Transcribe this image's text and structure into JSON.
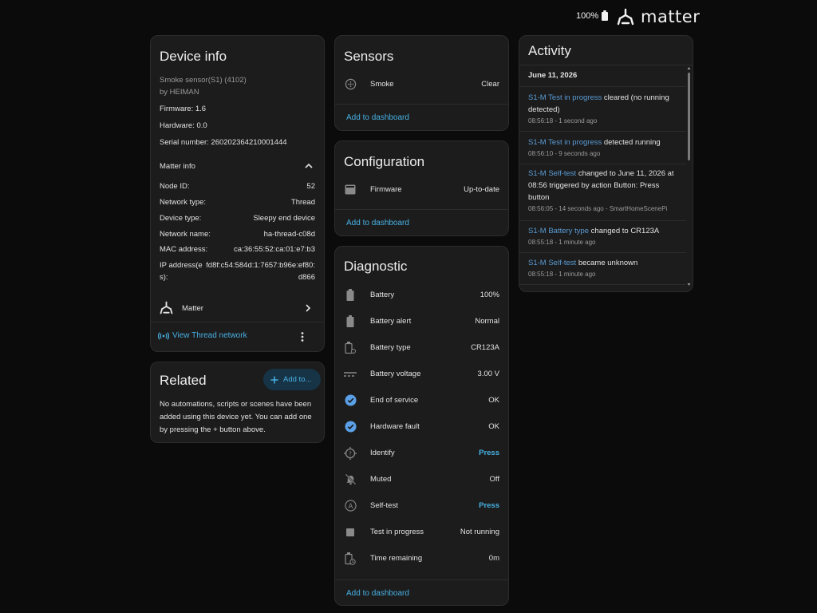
{
  "status_bar": {
    "battery_percent": "100%",
    "brand": "matter"
  },
  "device_info": {
    "title": "Device info",
    "model": "Smoke sensor(S1) (4102)",
    "manufacturer": "by HEIMAN",
    "firmware": "Firmware: 1.6",
    "hardware": "Hardware: 0.0",
    "serial": "Serial number: 260202364210001444",
    "matter_info_label": "Matter info",
    "matter_rows": [
      {
        "label": "Node ID:",
        "value": "52"
      },
      {
        "label": "Network type:",
        "value": "Thread"
      },
      {
        "label": "Device type:",
        "value": "Sleepy end device"
      },
      {
        "label": "Network name:",
        "value": "ha-thread-c08d"
      },
      {
        "label": "MAC address:",
        "value": "ca:36:55:52:ca:01:e7:b3"
      }
    ],
    "ip_label_line1": "IP address(e",
    "ip_label_line2": "s):",
    "ip_value_line1": "fd8f:c54:584d:1:7657:b96e:ef80:",
    "ip_value_line2": "d866",
    "integration": "Matter",
    "view_thread": "View Thread network"
  },
  "related": {
    "title": "Related",
    "add_label": "Add to...",
    "body": "No automations, scripts or scenes have been added using this device yet. You can add one by pressing the + button above."
  },
  "sensors": {
    "title": "Sensors",
    "rows": [
      {
        "icon": "smoke-detector-icon",
        "name": "Smoke",
        "value": "Clear"
      }
    ],
    "add_dashboard": "Add to dashboard"
  },
  "configuration": {
    "title": "Configuration",
    "rows": [
      {
        "icon": "firmware-icon",
        "name": "Firmware",
        "value": "Up-to-date"
      }
    ],
    "add_dashboard": "Add to dashboard"
  },
  "diagnostic": {
    "title": "Diagnostic",
    "rows": [
      {
        "icon": "battery-icon",
        "name": "Battery",
        "value": "100%"
      },
      {
        "icon": "battery-alert-icon",
        "name": "Battery alert",
        "value": "Normal"
      },
      {
        "icon": "battery-type-icon",
        "name": "Battery type",
        "value": "CR123A"
      },
      {
        "icon": "battery-voltage-icon",
        "name": "Battery voltage",
        "value": "3.00 V"
      },
      {
        "icon": "check-circle-icon",
        "name": "End of service",
        "value": "OK"
      },
      {
        "icon": "check-circle-icon",
        "name": "Hardware fault",
        "value": "OK"
      },
      {
        "icon": "identify-icon",
        "name": "Identify",
        "value": "Press"
      },
      {
        "icon": "bell-off-icon",
        "name": "Muted",
        "value": "Off"
      },
      {
        "icon": "self-test-icon",
        "name": "Self-test",
        "value": "Press"
      },
      {
        "icon": "square-icon",
        "name": "Test in progress",
        "value": "Not running"
      },
      {
        "icon": "timer-icon",
        "name": "Time remaining",
        "value": "0m"
      }
    ],
    "add_dashboard": "Add to dashboard"
  },
  "activity": {
    "title": "Activity",
    "date": "June 11, 2026",
    "entries": [
      {
        "entity": "S1-M Test in progress",
        "line1_rest": " cleared (no running",
        "line2": "detected)",
        "time": "08:56:18 - 1 second ago"
      },
      {
        "entity": "S1-M Test in progress",
        "line1_rest": " detected running",
        "time": "08:56:10 - 9 seconds ago"
      },
      {
        "entity": "S1-M Self-test",
        "line1_rest": " changed to June 11, 2026 at",
        "line2": "08:56 triggered by action Button: Press",
        "line3": "button",
        "time": "08:56:05 - 14 seconds ago - SmartHomeScenePi"
      },
      {
        "entity": "S1-M Battery type",
        "line1_rest": " changed to CR123A",
        "time": "08:55:18 - 1 minute ago"
      },
      {
        "entity": "S1-M Self-test",
        "line1_rest": " became unknown",
        "time": "08:55:18 - 1 minute ago"
      }
    ]
  },
  "colors": {
    "background": "#0b0b0b",
    "card": "#1c1c1c",
    "accent": "#47b0e3",
    "entity_link": "#5a9bd4"
  }
}
